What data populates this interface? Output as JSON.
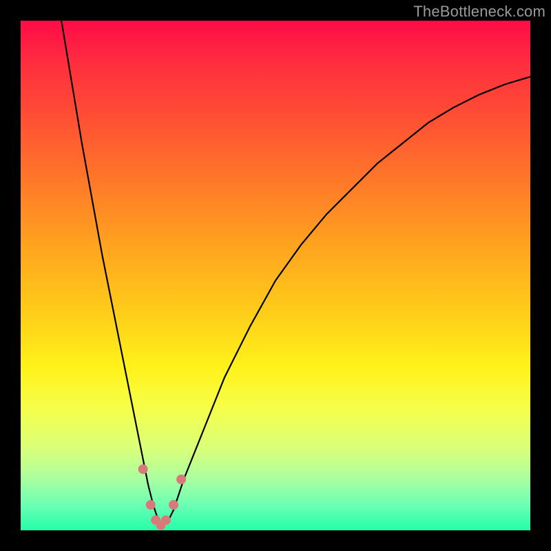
{
  "watermark": "TheBottleneck.com",
  "chart_data": {
    "type": "line",
    "title": "",
    "xlabel": "",
    "ylabel": "",
    "xlim": [
      0,
      100
    ],
    "ylim": [
      0,
      100
    ],
    "series": [
      {
        "name": "bottleneck-curve",
        "color": "#000000",
        "x": [
          8,
          10,
          12,
          14,
          16,
          18,
          20,
          22,
          24,
          25,
          26,
          27,
          28,
          29,
          30,
          32,
          36,
          40,
          45,
          50,
          55,
          60,
          65,
          70,
          75,
          80,
          85,
          90,
          95,
          100
        ],
        "values": [
          100,
          88,
          76,
          65,
          54,
          44,
          34,
          24,
          14,
          9,
          5,
          2,
          1,
          2,
          4,
          10,
          20,
          30,
          40,
          49,
          56,
          62,
          67,
          72,
          76,
          80,
          83,
          85.5,
          87.5,
          89
        ]
      }
    ],
    "markers": {
      "name": "bottom-cluster",
      "color": "#d97a7a",
      "points": [
        {
          "x": 24.0,
          "y": 12.0
        },
        {
          "x": 25.5,
          "y": 5.0
        },
        {
          "x": 26.5,
          "y": 2.0
        },
        {
          "x": 27.5,
          "y": 1.0
        },
        {
          "x": 28.5,
          "y": 2.0
        },
        {
          "x": 30.0,
          "y": 5.0
        },
        {
          "x": 31.5,
          "y": 10.0
        }
      ]
    }
  }
}
